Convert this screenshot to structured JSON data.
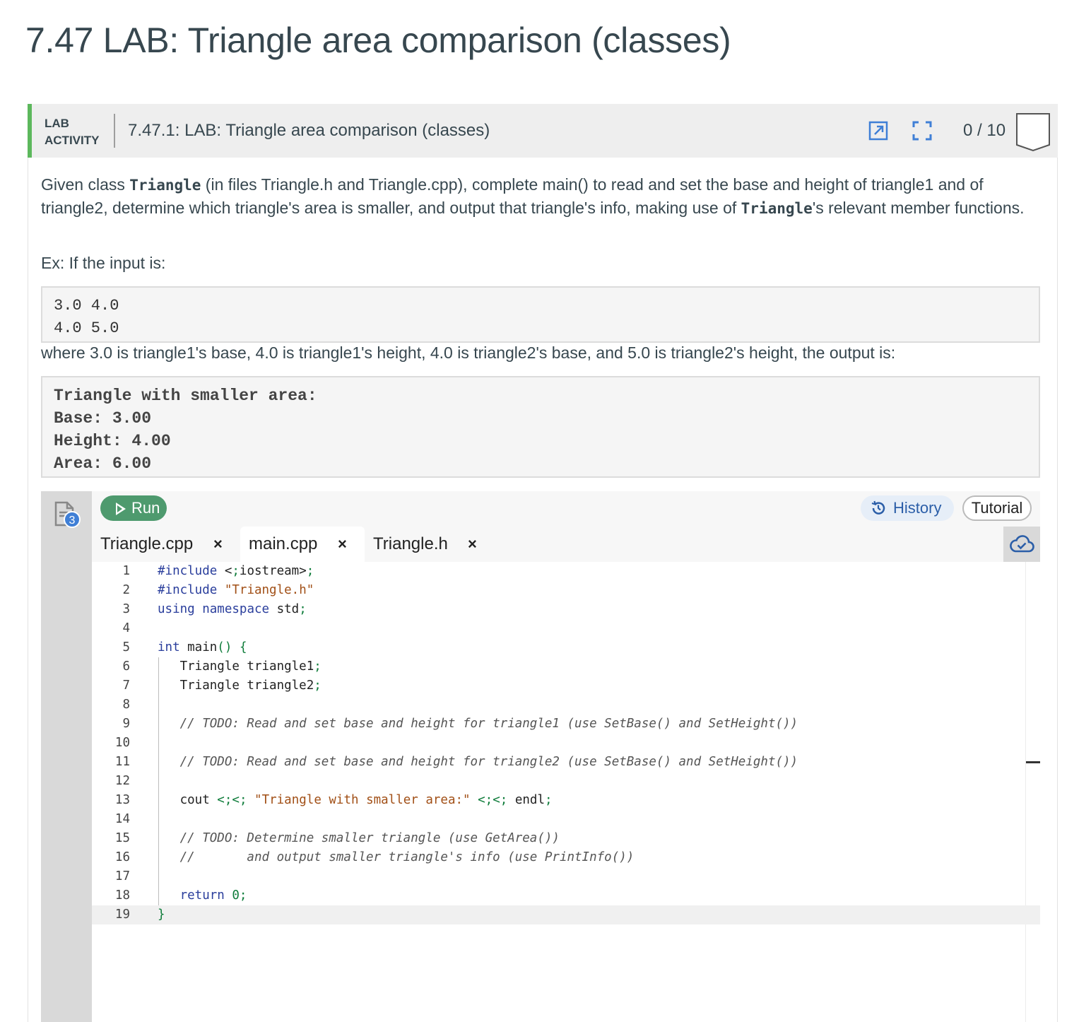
{
  "page": {
    "title": "7.47 LAB: Triangle area comparison (classes)"
  },
  "activity": {
    "label_line1": "LAB",
    "label_line2": "ACTIVITY",
    "title": "7.47.1: LAB: Triangle area comparison (classes)",
    "score": "0 / 10",
    "accent_color": "#5cb85c"
  },
  "description": {
    "p1_a": "Given class ",
    "p1_code1": "Triangle",
    "p1_b": " (in files Triangle.h and Triangle.cpp), complete main() to read and set the base and height of triangle1 and of triangle2, determine which triangle's area is smaller, and output that triangle's info, making use of ",
    "p1_code2": "Triangle",
    "p1_c": "'s relevant member functions.",
    "ex_label": "Ex: If the input is:",
    "input_lines": [
      "3.0 4.0",
      "4.0 5.0"
    ],
    "where_text": "where 3.0 is triangle1's base, 4.0 is triangle1's height, 4.0 is triangle2's base, and 5.0 is triangle2's height, the output is:",
    "output_lines": [
      "Triangle with smaller area:",
      "Base: 3.00",
      "Height: 4.00",
      "Area: 6.00"
    ]
  },
  "ide": {
    "file_badge": "3",
    "run_label": "Run",
    "history_label": "History",
    "tutorial_label": "Tutorial",
    "tabs": [
      {
        "label": "Triangle.cpp",
        "close": "×",
        "active": false
      },
      {
        "label": "main.cpp",
        "close": "×",
        "active": true
      },
      {
        "label": "Triangle.h",
        "close": "×",
        "active": false
      }
    ],
    "code_lines": [
      "#include <iostream>",
      "#include \"Triangle.h\"",
      "using namespace std;",
      "",
      "int main() {",
      "   Triangle triangle1;",
      "   Triangle triangle2;",
      "",
      "   // TODO: Read and set base and height for triangle1 (use SetBase() and SetHeight())",
      "",
      "   // TODO: Read and set base and height for triangle2 (use SetBase() and SetHeight())",
      "",
      "   cout << \"Triangle with smaller area:\" << endl;",
      "",
      "   // TODO: Determine smaller triangle (use GetArea())",
      "   //       and output smaller triangle's info (use PrintInfo())",
      "",
      "   return 0;",
      "}"
    ],
    "current_line": 19
  }
}
